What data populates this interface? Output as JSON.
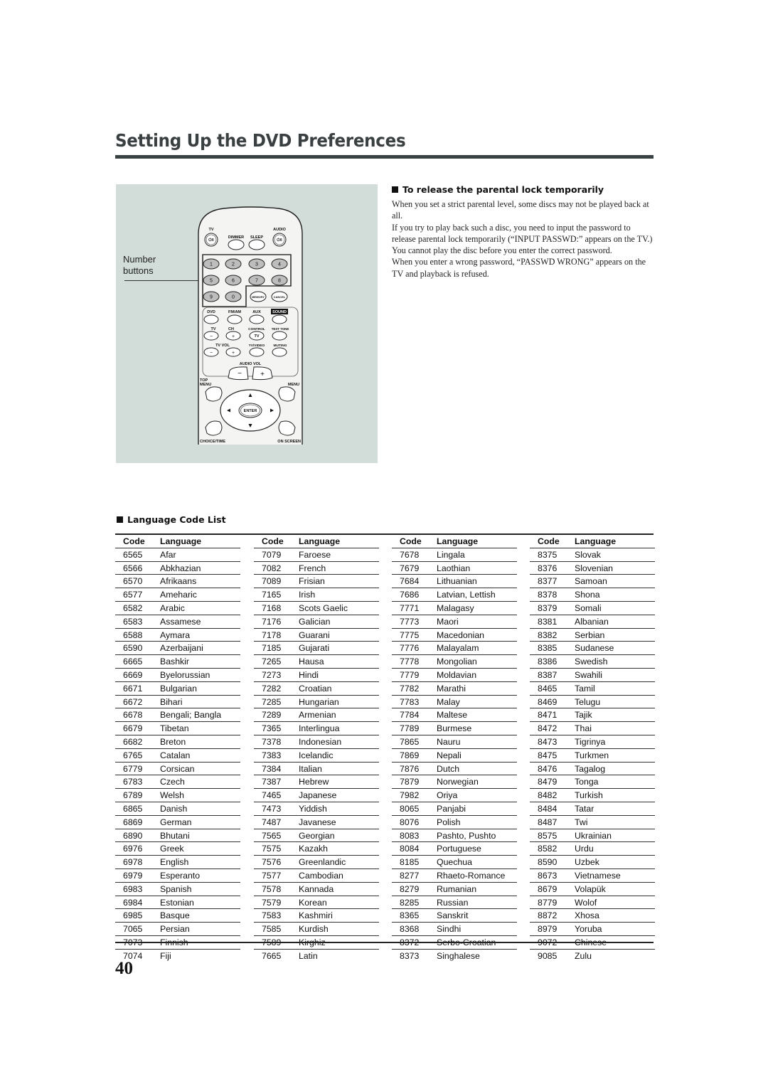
{
  "page": {
    "title": "Setting Up the DVD Preferences",
    "page_number": "40"
  },
  "illustration": {
    "callout_label_line1": "Number",
    "callout_label_line2": "buttons",
    "remote": {
      "top_labels": [
        "TV",
        "DIMMER",
        "SLEEP",
        "AUDIO"
      ],
      "power_symbol": "⏻/I",
      "number_buttons": [
        "1",
        "2",
        "3",
        "4",
        "5",
        "6",
        "7",
        "8",
        "9",
        "0"
      ],
      "memory_label": "MEMORY",
      "cancel_label": "CANCEL",
      "source_labels": [
        "DVD",
        "FM/AM",
        "AUX",
        "SOUND"
      ],
      "row3_labels": [
        "TV",
        "CH",
        "CONTROL",
        "TEST TONE"
      ],
      "row4_labels": [
        "TV VOL",
        "TV/VIDEO",
        "MUTING"
      ],
      "tv_button_label": "TV",
      "minus": "−",
      "plus": "+",
      "audio_vol_label": "AUDIO VOL",
      "top_menu_label_1": "TOP",
      "top_menu_label_2": "MENU",
      "menu_label": "MENU",
      "enter_label": "ENTER",
      "choice_time_label": "CHOICE/TIME",
      "on_screen_label": "ON SCREEN"
    }
  },
  "parental_lock": {
    "heading": "To release the parental lock temporarily",
    "paragraphs": [
      "When you set a strict parental level, some discs may not be played back at all.",
      "If you try to play back such a disc, you need to input the password to release parental lock temporarily (“INPUT PASSWD:” appears on the TV.)  You cannot play the disc before you enter the correct password.",
      "When you enter a wrong password, “PASSWD WRONG” appears on the TV and playback is refused."
    ]
  },
  "language_list": {
    "heading": "Language Code List",
    "column_headers": {
      "code": "Code",
      "language": "Language"
    },
    "columns": [
      [
        [
          "6565",
          "Afar"
        ],
        [
          "6566",
          "Abkhazian"
        ],
        [
          "6570",
          "Afrikaans"
        ],
        [
          "6577",
          "Ameharic"
        ],
        [
          "6582",
          "Arabic"
        ],
        [
          "6583",
          "Assamese"
        ],
        [
          "6588",
          "Aymara"
        ],
        [
          "6590",
          "Azerbaijani"
        ],
        [
          "6665",
          "Bashkir"
        ],
        [
          "6669",
          "Byelorussian"
        ],
        [
          "6671",
          "Bulgarian"
        ],
        [
          "6672",
          "Bihari"
        ],
        [
          "6678",
          "Bengali; Bangla"
        ],
        [
          "6679",
          "Tibetan"
        ],
        [
          "6682",
          "Breton"
        ],
        [
          "6765",
          "Catalan"
        ],
        [
          "6779",
          "Corsican"
        ],
        [
          "6783",
          "Czech"
        ],
        [
          "6789",
          "Welsh"
        ],
        [
          "6865",
          "Danish"
        ],
        [
          "6869",
          "German"
        ],
        [
          "6890",
          "Bhutani"
        ],
        [
          "6976",
          "Greek"
        ],
        [
          "6978",
          "English"
        ],
        [
          "6979",
          "Esperanto"
        ],
        [
          "6983",
          "Spanish"
        ],
        [
          "6984",
          "Estonian"
        ],
        [
          "6985",
          "Basque"
        ],
        [
          "7065",
          "Persian"
        ],
        [
          "7073",
          "Finnish"
        ],
        [
          "7074",
          "Fiji"
        ]
      ],
      [
        [
          "7079",
          "Faroese"
        ],
        [
          "7082",
          "French"
        ],
        [
          "7089",
          "Frisian"
        ],
        [
          "7165",
          "Irish"
        ],
        [
          "7168",
          "Scots Gaelic"
        ],
        [
          "7176",
          "Galician"
        ],
        [
          "7178",
          "Guarani"
        ],
        [
          "7185",
          "Gujarati"
        ],
        [
          "7265",
          "Hausa"
        ],
        [
          "7273",
          "Hindi"
        ],
        [
          "7282",
          "Croatian"
        ],
        [
          "7285",
          "Hungarian"
        ],
        [
          "7289",
          "Armenian"
        ],
        [
          "7365",
          "Interlingua"
        ],
        [
          "7378",
          "Indonesian"
        ],
        [
          "7383",
          "Icelandic"
        ],
        [
          "7384",
          "Italian"
        ],
        [
          "7387",
          "Hebrew"
        ],
        [
          "7465",
          "Japanese"
        ],
        [
          "7473",
          "Yiddish"
        ],
        [
          "7487",
          "Javanese"
        ],
        [
          "7565",
          "Georgian"
        ],
        [
          "7575",
          "Kazakh"
        ],
        [
          "7576",
          "Greenlandic"
        ],
        [
          "7577",
          "Cambodian"
        ],
        [
          "7578",
          "Kannada"
        ],
        [
          "7579",
          "Korean"
        ],
        [
          "7583",
          "Kashmiri"
        ],
        [
          "7585",
          "Kurdish"
        ],
        [
          "7589",
          "Kirghiz"
        ],
        [
          "7665",
          "Latin"
        ]
      ],
      [
        [
          "7678",
          "Lingala"
        ],
        [
          "7679",
          "Laothian"
        ],
        [
          "7684",
          "Lithuanian"
        ],
        [
          "7686",
          "Latvian, Lettish"
        ],
        [
          "7771",
          "Malagasy"
        ],
        [
          "7773",
          "Maori"
        ],
        [
          "7775",
          "Macedonian"
        ],
        [
          "7776",
          "Malayalam"
        ],
        [
          "7778",
          "Mongolian"
        ],
        [
          "7779",
          "Moldavian"
        ],
        [
          "7782",
          "Marathi"
        ],
        [
          "7783",
          "Malay"
        ],
        [
          "7784",
          "Maltese"
        ],
        [
          "7789",
          "Burmese"
        ],
        [
          "7865",
          "Nauru"
        ],
        [
          "7869",
          "Nepali"
        ],
        [
          "7876",
          "Dutch"
        ],
        [
          "7879",
          "Norwegian"
        ],
        [
          "7982",
          "Oriya"
        ],
        [
          "8065",
          "Panjabi"
        ],
        [
          "8076",
          "Polish"
        ],
        [
          "8083",
          "Pashto, Pushto"
        ],
        [
          "8084",
          "Portuguese"
        ],
        [
          "8185",
          "Quechua"
        ],
        [
          "8277",
          "Rhaeto-Romance"
        ],
        [
          "8279",
          "Rumanian"
        ],
        [
          "8285",
          "Russian"
        ],
        [
          "8365",
          "Sanskrit"
        ],
        [
          "8368",
          "Sindhi"
        ],
        [
          "8372",
          "Serbo-Croatian"
        ],
        [
          "8373",
          "Singhalese"
        ]
      ],
      [
        [
          "8375",
          "Slovak"
        ],
        [
          "8376",
          "Slovenian"
        ],
        [
          "8377",
          "Samoan"
        ],
        [
          "8378",
          "Shona"
        ],
        [
          "8379",
          "Somali"
        ],
        [
          "8381",
          "Albanian"
        ],
        [
          "8382",
          "Serbian"
        ],
        [
          "8385",
          "Sudanese"
        ],
        [
          "8386",
          "Swedish"
        ],
        [
          "8387",
          "Swahili"
        ],
        [
          "8465",
          "Tamil"
        ],
        [
          "8469",
          "Telugu"
        ],
        [
          "8471",
          "Tajik"
        ],
        [
          "8472",
          "Thai"
        ],
        [
          "8473",
          "Tigrinya"
        ],
        [
          "8475",
          "Turkmen"
        ],
        [
          "8476",
          "Tagalog"
        ],
        [
          "8479",
          "Tonga"
        ],
        [
          "8482",
          "Turkish"
        ],
        [
          "8484",
          "Tatar"
        ],
        [
          "8487",
          "Twi"
        ],
        [
          "8575",
          "Ukrainian"
        ],
        [
          "8582",
          "Urdu"
        ],
        [
          "8590",
          "Uzbek"
        ],
        [
          "8673",
          "Vietnamese"
        ],
        [
          "8679",
          "Volapük"
        ],
        [
          "8779",
          "Wolof"
        ],
        [
          "8872",
          "Xhosa"
        ],
        [
          "8979",
          "Yoruba"
        ],
        [
          "9072",
          "Chinese"
        ],
        [
          "9085",
          "Zulu"
        ]
      ]
    ]
  }
}
